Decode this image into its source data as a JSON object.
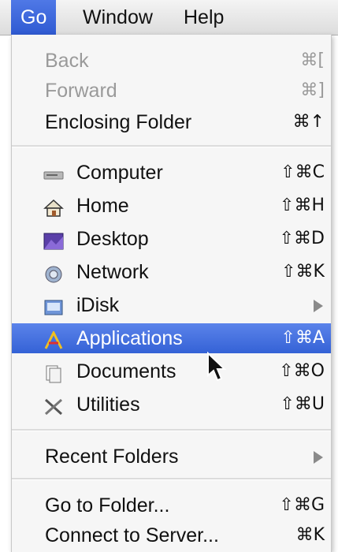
{
  "menubar": {
    "items": [
      "Go",
      "Window",
      "Help"
    ]
  },
  "menu": {
    "back": {
      "label": "Back",
      "shortcut": "⌘["
    },
    "forward": {
      "label": "Forward",
      "shortcut": "⌘]"
    },
    "enclosing": {
      "label": "Enclosing Folder",
      "shortcut": "⌘↑"
    },
    "computer": {
      "label": "Computer",
      "shortcut": "⇧⌘C",
      "icon": "computer-icon"
    },
    "home": {
      "label": "Home",
      "shortcut": "⇧⌘H",
      "icon": "home-icon"
    },
    "desktop": {
      "label": "Desktop",
      "shortcut": "⇧⌘D",
      "icon": "desktop-icon"
    },
    "network": {
      "label": "Network",
      "shortcut": "⇧⌘K",
      "icon": "network-icon"
    },
    "idisk": {
      "label": "iDisk",
      "icon": "idisk-icon"
    },
    "applications": {
      "label": "Applications",
      "shortcut": "⇧⌘A",
      "icon": "applications-icon"
    },
    "documents": {
      "label": "Documents",
      "shortcut": "⇧⌘O",
      "icon": "documents-icon"
    },
    "utilities": {
      "label": "Utilities",
      "shortcut": "⇧⌘U",
      "icon": "utilities-icon"
    },
    "recent": {
      "label": "Recent Folders"
    },
    "gotofolder": {
      "label": "Go to Folder...",
      "shortcut": "⇧⌘G"
    },
    "connect": {
      "label": "Connect to Server...",
      "shortcut": "⌘K"
    }
  },
  "colors": {
    "highlight": "#3462d6",
    "disabled_text": "#9a9a9a"
  }
}
